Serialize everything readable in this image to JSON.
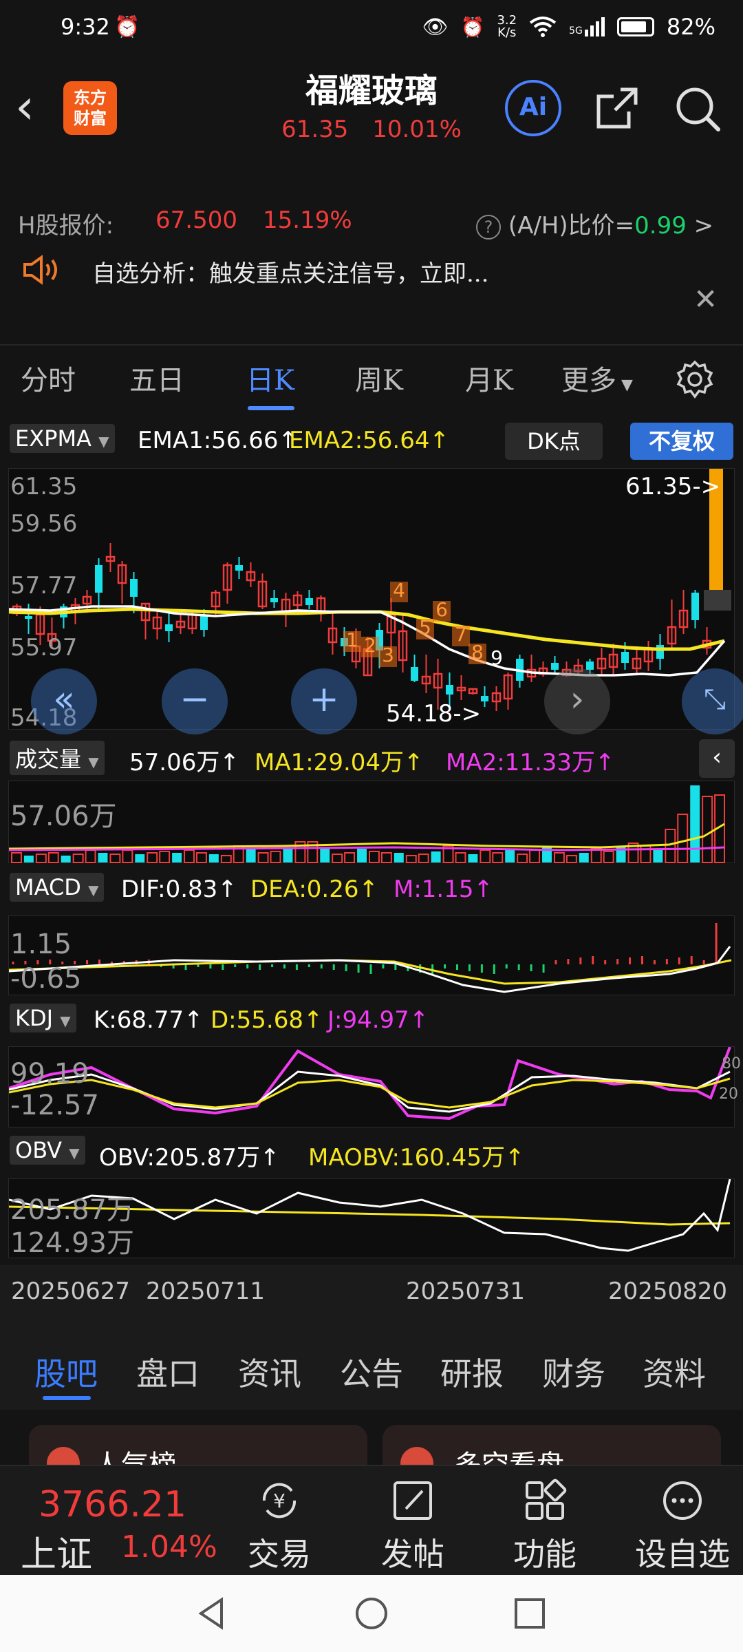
{
  "status_bar": {
    "time": "9:32",
    "net_speed_value": "3.2",
    "net_speed_unit": "K/s",
    "signal": "5G",
    "battery": "82%"
  },
  "header": {
    "logo_line1": "东方",
    "logo_line2": "财富",
    "stock_name": "福耀玻璃",
    "price": "61.35",
    "change_pct": "10.01%",
    "ai_label": "Ai"
  },
  "hshare": {
    "label": "H股报价:",
    "price": "67.500",
    "change_pct": "15.19%",
    "ratio_label": "(A/H)比价=",
    "ratio_value": "0.99",
    "chevron": ">"
  },
  "analysis": {
    "text": "自选分析：触发重点关注信号，立即..."
  },
  "period_tabs": [
    "分时",
    "五日",
    "日K",
    "周K",
    "月K",
    "更多"
  ],
  "kline": {
    "indicator": "EXPMA",
    "ema1": "EMA1:56.66",
    "ema2": "EMA2:56.64",
    "dk_label": "DK点",
    "fq_label": "不复权",
    "y_labels": [
      "61.35",
      "59.56",
      "57.77",
      "55.97",
      "54.18"
    ],
    "high_marker": "61.35->",
    "low_marker": "54.18->",
    "signals": [
      "1",
      "2",
      "3",
      "4",
      "5",
      "6",
      "7",
      "8",
      "9"
    ]
  },
  "volume": {
    "indicator": "成交量",
    "vol": "57.06万",
    "ma1": "MA1:29.04万",
    "ma2": "MA2:11.33万",
    "y_label": "57.06万"
  },
  "macd": {
    "indicator": "MACD",
    "dif": "DIF:0.83",
    "dea": "DEA:0.26",
    "m": "M:1.15",
    "y_top": "1.15",
    "y_bottom": "-0.65"
  },
  "kdj": {
    "indicator": "KDJ",
    "k": "K:68.77",
    "d": "D:55.68",
    "j": "J:94.97",
    "y_top": "99.19",
    "y_bottom": "-12.57",
    "right_top": "80",
    "right_bottom": "20"
  },
  "obv": {
    "indicator": "OBV",
    "obv": "OBV:205.87万",
    "maobv": "MAOBV:160.45万",
    "y_top": "205.87万",
    "y_bottom": "124.93万"
  },
  "dates": [
    "20250627",
    "20250711",
    "20250731",
    "20250820"
  ],
  "content_tabs": [
    "股吧",
    "盘口",
    "资讯",
    "公告",
    "研报",
    "财务",
    "资料"
  ],
  "cards": {
    "left": "人气榜",
    "right": "多空看盘"
  },
  "bottom_nav": {
    "index_value": "3766.21",
    "index_name": "上证",
    "index_pct": "1.04%",
    "items": [
      "交易",
      "发帖",
      "功能",
      "设自选"
    ]
  },
  "colors": {
    "up": "#f23c3c",
    "down": "#19e0e8",
    "ema1": "#ffffff",
    "ema2": "#f5e621",
    "accent": "#4f8bff"
  }
}
